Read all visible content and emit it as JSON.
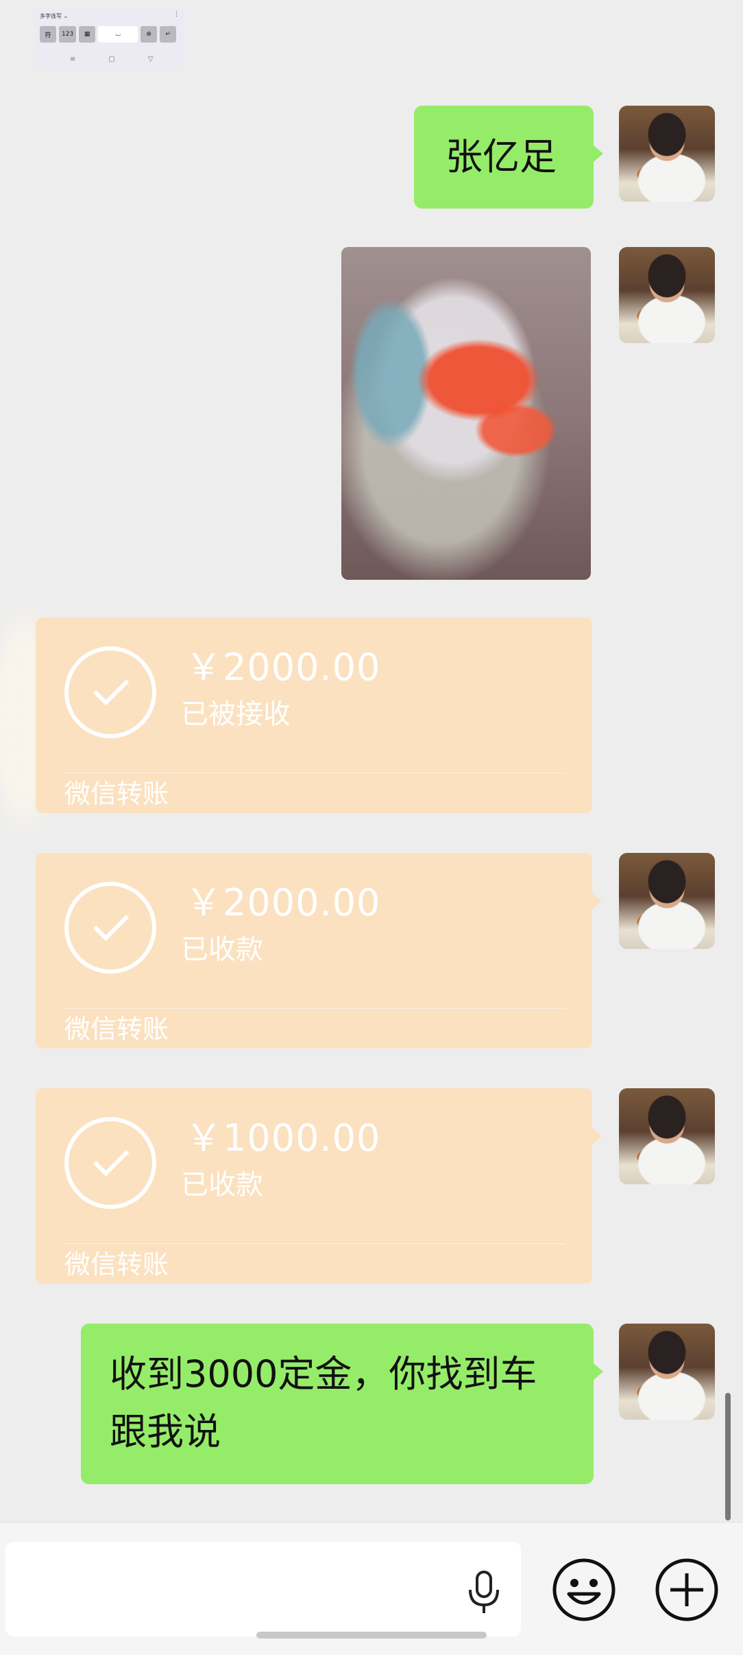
{
  "keyboard_thumb": {
    "mode_label": "多字连写 ⌄",
    "menu_dots": "⋮",
    "keys": [
      "符",
      "123",
      "",
      "",
      "",
      "↵"
    ],
    "nav": [
      "≡",
      "▢",
      "▽"
    ]
  },
  "messages": [
    {
      "type": "text",
      "text": "张亿足"
    },
    {
      "type": "image",
      "alt": "photo"
    },
    {
      "type": "transfer",
      "amount": "￥2000.00",
      "status": "已被接收",
      "brand": "微信转账"
    },
    {
      "type": "transfer",
      "amount": "￥2000.00",
      "status": "已收款",
      "brand": "微信转账"
    },
    {
      "type": "transfer",
      "amount": "￥1000.00",
      "status": "已收款",
      "brand": "微信转账"
    },
    {
      "type": "text",
      "text_line1": "收到3000定金，你找到车",
      "text_line2": "跟我说"
    }
  ],
  "colors": {
    "background": "#ededed",
    "green_bubble": "#95ec69",
    "transfer_bubble": "#fbe1c0",
    "bottom_bar": "#f5f5f5"
  },
  "input_bar": {
    "input_value": "",
    "icons": [
      "microphone-icon",
      "emoji-icon",
      "plus-icon"
    ]
  }
}
